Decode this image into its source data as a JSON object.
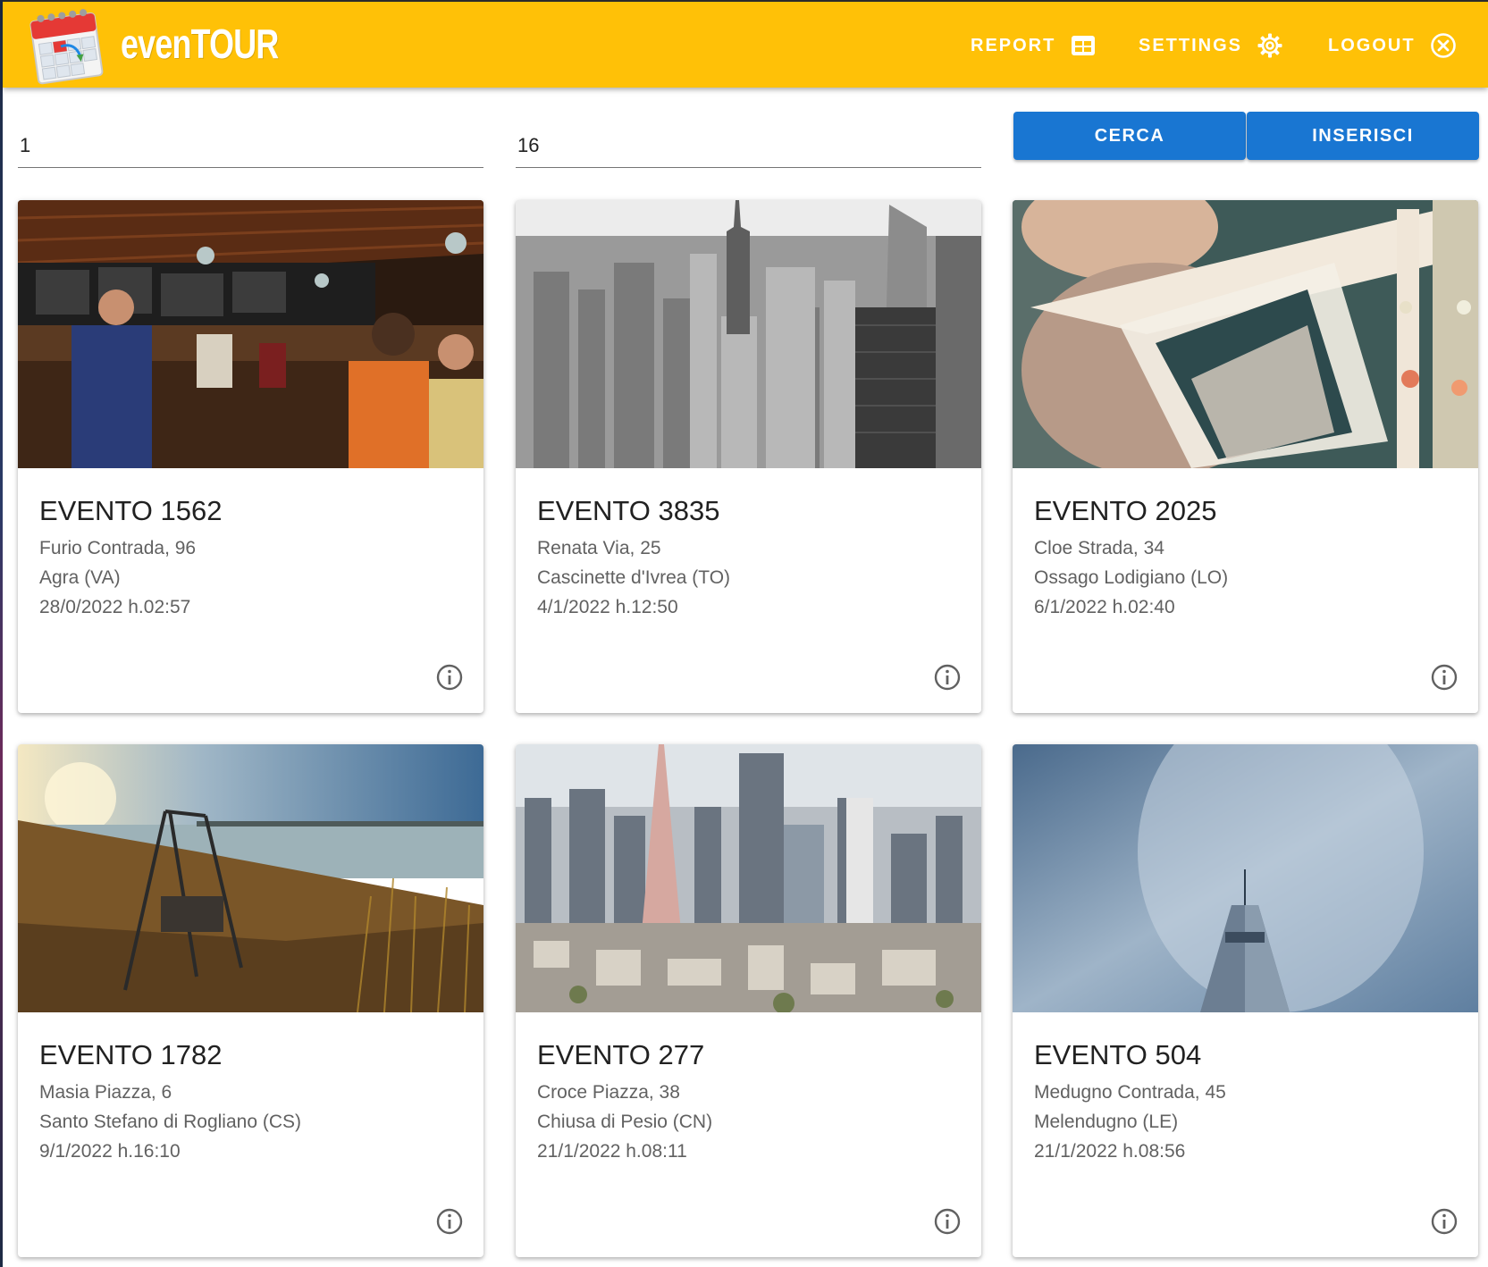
{
  "app": {
    "title": "evenTOUR"
  },
  "header": {
    "report_label": "REPORT",
    "settings_label": "SETTINGS",
    "logout_label": "LOGOUT"
  },
  "search": {
    "field1_value": "1",
    "field2_value": "16",
    "cerca_label": "CERCA",
    "inserisci_label": "INSERISCI"
  },
  "colors": {
    "accent": "#ffc107",
    "primary": "#1976d2"
  },
  "events": [
    {
      "title": "EVENTO 1562",
      "address": "Furio Contrada, 96",
      "city": "Agra (VA)",
      "datetime": "28/0/2022 h.02:57",
      "image": "bar-interior-photo"
    },
    {
      "title": "EVENTO 3835",
      "address": "Renata Via, 25",
      "city": "Cascinette d'Ivrea (TO)",
      "datetime": "4/1/2022 h.12:50",
      "image": "city-skyline-bw-photo"
    },
    {
      "title": "EVENTO 2025",
      "address": "Cloe Strada, 34",
      "city": "Ossago Lodigiano (LO)",
      "datetime": "6/1/2022 h.02:40",
      "image": "bride-in-car-photo"
    },
    {
      "title": "EVENTO 1782",
      "address": "Masia Piazza, 6",
      "city": "Santo Stefano di Rogliano (CS)",
      "datetime": "9/1/2022 h.16:10",
      "image": "swing-by-lake-photo"
    },
    {
      "title": "EVENTO 277",
      "address": "Croce Piazza, 38",
      "city": "Chiusa di Pesio (CN)",
      "datetime": "21/1/2022 h.08:11",
      "image": "city-aerial-photo"
    },
    {
      "title": "EVENTO 504",
      "address": "Medugno Contrada, 45",
      "city": "Melendugno (LE)",
      "datetime": "21/1/2022 h.08:56",
      "image": "tower-sky-photo"
    }
  ]
}
